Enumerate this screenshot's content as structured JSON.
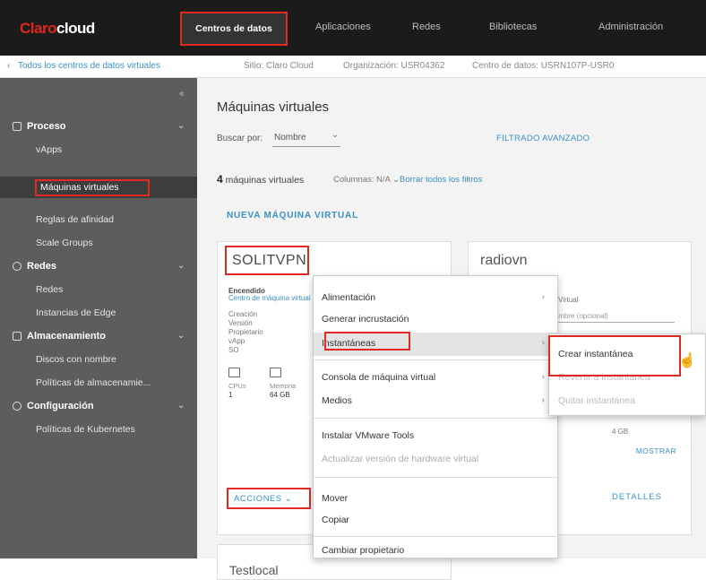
{
  "topbar": {
    "logo_brand": "Claro",
    "logo_product": "cloud",
    "active_tab": "Centros de datos",
    "tabs": [
      "Aplicaciones",
      "Redes",
      "Bibliotecas",
      "Administración"
    ]
  },
  "breadcrumb": {
    "back": "Todos los centros de datos virtuales",
    "site": "Sitio: Claro Cloud",
    "org": "Organización: USR04362",
    "vdc": "Centro de datos: USRN107P-USR0"
  },
  "sidebar": {
    "collapse": "«",
    "sections": [
      {
        "label": "Proceso",
        "items": [
          "vApps",
          "Máquinas virtuales",
          "Reglas de afinidad",
          "Scale Groups"
        ]
      },
      {
        "label": "Redes",
        "items": [
          "Redes",
          "Instancias de Edge"
        ]
      },
      {
        "label": "Almacenamiento",
        "items": [
          "Discos con nombre",
          "Políticas de almacenamie..."
        ]
      },
      {
        "label": "Configuración",
        "items": [
          "Políticas de Kubernetes"
        ]
      }
    ]
  },
  "main": {
    "title": "Máquinas virtuales",
    "search_label": "Buscar por:",
    "search_value": "Nombre",
    "advanced_filters": "FILTRADO AVANZADO",
    "count_number": "4",
    "count_label": "máquinas virtuales",
    "column_picker": "Columnas: N/A ⌄",
    "clear_filters": "Borrar todos los filtros",
    "new_vm": "NUEVA MÁQUINA VIRTUAL"
  },
  "cards": [
    {
      "name": "SOLITVPN",
      "status": "Encendido",
      "status_link": "Centro de máquina virtual",
      "fields": [
        "Creación",
        "Versión",
        "Propietario",
        "vApp",
        "SO"
      ],
      "metrics": [
        {
          "label": "CPUs",
          "value": "1"
        },
        {
          "label": "Memoria",
          "value": "64 GB"
        }
      ],
      "actions": "ACCIONES ⌄"
    },
    {
      "name": "radiovn",
      "field_label": "Virtual",
      "field_value": "Nombre (opcional)",
      "metric_value": "4 GB",
      "upgrade": "MOSTRAR",
      "details": "DETALLES"
    },
    {
      "name": "Testlocal"
    }
  ],
  "context_menu": {
    "items": [
      {
        "label": "Alimentación",
        "has_submenu": true,
        "state": "normal"
      },
      {
        "label": "Generar incrustación",
        "has_submenu": false,
        "state": "normal"
      },
      {
        "label": "Instantáneas",
        "has_submenu": true,
        "state": "highlighted"
      },
      {
        "label": "Consola de máquina virtual",
        "has_submenu": true,
        "state": "normal"
      },
      {
        "label": "Medios",
        "has_submenu": true,
        "state": "normal"
      },
      {
        "label": "Instalar VMware Tools",
        "has_submenu": false,
        "state": "normal"
      },
      {
        "label": "Actualizar versión de hardware virtual",
        "has_submenu": false,
        "state": "disabled"
      },
      {
        "label": "Mover",
        "has_submenu": false,
        "state": "normal"
      },
      {
        "label": "Copiar",
        "has_submenu": false,
        "state": "normal"
      },
      {
        "label": "Cambiar propietario",
        "has_submenu": false,
        "state": "normal"
      }
    ]
  },
  "submenu": {
    "items": [
      {
        "label": "Crear instantánea",
        "state": "normal"
      },
      {
        "label": "Revertir a instantánea",
        "state": "disabled"
      },
      {
        "label": "Quitar instantánea",
        "state": "disabled"
      }
    ]
  },
  "colors": {
    "accent_red": "#e02a20",
    "link_blue": "#3a8fc4",
    "topbar": "#1b1b1b",
    "sidebar": "#5d5d5d"
  }
}
